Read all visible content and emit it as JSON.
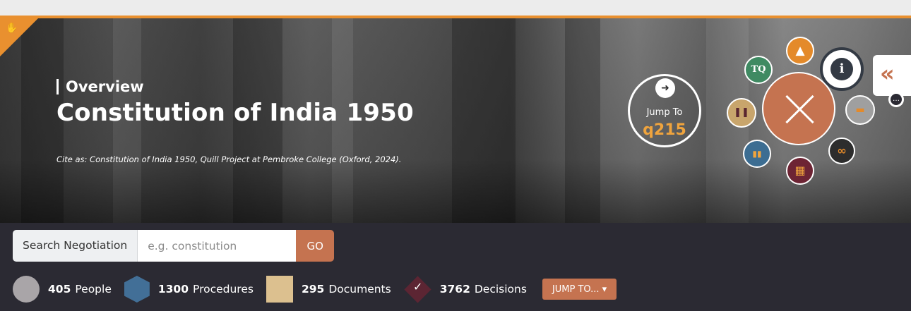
{
  "hero": {
    "kicker": "Overview",
    "title": "Constitution of India 1950",
    "cite": "Cite as: Constitution of India 1950, Quill Project at Pembroke College (Oxford, 2024)."
  },
  "menu": {
    "jump_label": "Jump To",
    "jump_value": "q215",
    "orbs": [
      {
        "name": "tq-icon",
        "glyph": "TQ",
        "color": "#3f8a62"
      },
      {
        "name": "bell-tower-icon",
        "glyph": "▲",
        "color": "#e48a2a"
      },
      {
        "name": "info-icon",
        "glyph": "i",
        "color": "#333a44"
      },
      {
        "name": "books-icon",
        "glyph": "❚❚",
        "color": "#c8a56c"
      },
      {
        "name": "bar-chart-icon",
        "glyph": "▮▮",
        "color": "#3c6d92"
      },
      {
        "name": "calendar-icon",
        "glyph": "▦",
        "color": "#6d2434"
      },
      {
        "name": "binoculars-icon",
        "glyph": "∞",
        "color": "#2d2d2d"
      },
      {
        "name": "archive-icon",
        "glyph": "▬",
        "color": "#9f9f9f"
      }
    ]
  },
  "search": {
    "label": "Search Negotiation",
    "placeholder": "e.g. constitution",
    "go": "GO"
  },
  "stats": {
    "people_count": "405",
    "people_label": "People",
    "procedures_count": "1300",
    "procedures_label": "Procedures",
    "documents_count": "295",
    "documents_label": "Documents",
    "decisions_count": "3762",
    "decisions_label": "Decisions",
    "jump_button": "JUMP TO..."
  },
  "colors": {
    "accent": "#c57350",
    "orange": "#e9902f",
    "dark": "#2b2a33"
  }
}
